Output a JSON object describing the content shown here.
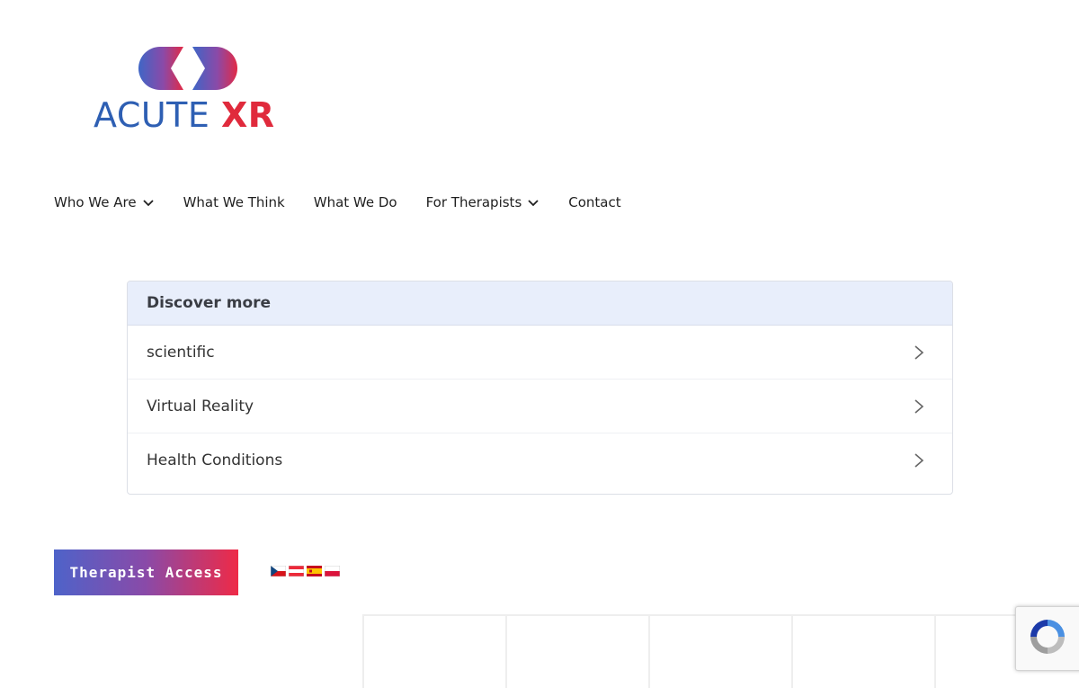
{
  "logo": {
    "word1": "ACUTE",
    "word2": "XR"
  },
  "nav": {
    "items": [
      {
        "label": "Who We Are",
        "has_dropdown": true
      },
      {
        "label": "What We Think",
        "has_dropdown": false
      },
      {
        "label": "What We Do",
        "has_dropdown": false
      },
      {
        "label": "For Therapists",
        "has_dropdown": true
      },
      {
        "label": "Contact",
        "has_dropdown": false
      }
    ]
  },
  "discover": {
    "title": "Discover more",
    "items": [
      {
        "label": "scientific"
      },
      {
        "label": "Virtual Reality"
      },
      {
        "label": "Health Conditions"
      }
    ]
  },
  "therapist_button": {
    "label": "Therapist Access"
  },
  "languages": [
    "czech-flag-icon",
    "austria-flag-icon",
    "spain-flag-icon",
    "poland-flag-icon"
  ],
  "colors": {
    "brand_blue": "#2e5fb3",
    "brand_red": "#e02a3c",
    "panel_header": "#e8eefb"
  }
}
